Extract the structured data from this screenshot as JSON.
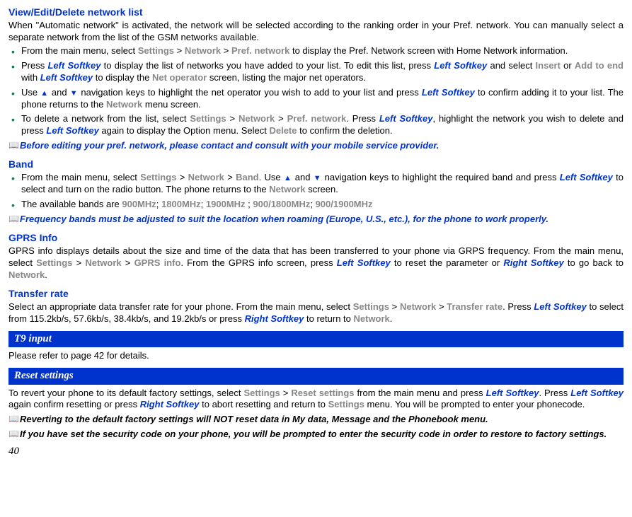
{
  "sections": {
    "viewEditDelete": {
      "title": "View/Edit/Delete network list",
      "intro": "When \"Automatic network\" is activated, the network will be selected according to the ranking order in your Pref. network. You can manually select a separate network from the list of the GSM networks available.",
      "bullets": [
        {
          "pre": "From the main menu, select ",
          "g1": "Settings",
          "gt1": " > ",
          "g2": "Network",
          "gt2": " > ",
          "g3": "Pref. network",
          "tail": " to display the Pref. Network screen with Home Network information."
        },
        {
          "pre": "Press ",
          "lsk1": "Left Softkey",
          "mid1": " to display the list of networks you have added to your list. To edit this list, press ",
          "lsk2": "Left Softkey",
          "mid2": " and select ",
          "g1": "Insert",
          "or": " or ",
          "g2": "Add to end",
          "mid3": " with ",
          "lsk3": "Left Softkey",
          "mid4": "  to display the ",
          "g3": "Net operator",
          "tail": " screen, listing the major net operators."
        },
        {
          "pre": "Use ",
          "aup": "▲",
          "and": " and ",
          "adn": "▼",
          "mid1": " navigation keys to highlight the net operator you wish to add to your list and press ",
          "lsk1": "Left Softkey",
          "mid2": " to confirm adding it to your list. The phone returns to the ",
          "g1": "Network",
          "tail": " menu screen."
        },
        {
          "pre": "To delete a network from the list, select ",
          "g1": "Settings",
          "gt1": " > ",
          "g2": "Network",
          "gt2": " > ",
          "g3": "Pref. network",
          "mid1": ". Press ",
          "lsk1": "Left Softkey",
          "mid2": ", highlight the network you wish to delete and press ",
          "lsk2": "Left Softkey",
          "mid3": " again to display the Option menu. Select ",
          "g4": "Delete",
          "tail": " to confirm the deletion."
        }
      ],
      "note": "Before editing your pref. network, please contact and consult with your mobile service provider."
    },
    "band": {
      "title": "Band",
      "bullets": [
        {
          "pre": "From the main menu, select ",
          "g1": "Settings",
          "gt1": " > ",
          "g2": "Network",
          "gt2": " > ",
          "g3": "Band",
          "mid1": ". Use ",
          "aup": "▲",
          "and": " and ",
          "adn": "▼",
          "mid2": " navigation keys to highlight the required band and press ",
          "lsk1": "Left Softkey",
          "mid3": " to select and turn on the radio button. The phone returns to the ",
          "g4": "Network",
          "tail": " screen."
        },
        {
          "pre": "The available bands are ",
          "g1": "900MHz",
          "sep1": "; ",
          "g2": "1800MHz",
          "sep2": "; ",
          "g3": "1900MHz ",
          "sep3": "; ",
          "g4": "900/1800MHz",
          "sep4": "; ",
          "g5": "900/1900MHz"
        }
      ],
      "note": "Frequency bands must be adjusted to suit the location when roaming (Europe, U.S., etc.), for the phone to work properly."
    },
    "gprs": {
      "title": "GPRS Info",
      "body": {
        "pre": "GPRS info displays details about the size and time of the data that has been transferred to your phone via GRPS frequency. From the main menu, select ",
        "g1": "Settings",
        "gt1": " > ",
        "g2": "Network ",
        "gt2": " > ",
        "g3": "GPRS info",
        "mid1": ". From the GPRS info screen, press ",
        "lsk1": "Left Softkey",
        "mid2": " to reset the parameter or ",
        "rsk1": "Right Softkey",
        "mid3": " to go back to ",
        "g4": "Network",
        "tail": "."
      }
    },
    "transfer": {
      "title": "Transfer rate",
      "body": {
        "pre": "Select an appropriate data transfer rate for your phone. From the main menu, select ",
        "g1": "Settings",
        "gt1": " > ",
        "g2": "Network ",
        "gt2": " > ",
        "g3": "Transfer rate",
        "mid1": ". Press ",
        "lsk1": "Left Softkey",
        "mid2": " to select from 115.2kb/s, 57.6kb/s, 38.4kb/s, and 19.2kb/s or press ",
        "rsk1": "Right Softkey",
        "mid3": " to return to ",
        "g4": "Network",
        "tail": "."
      }
    },
    "t9": {
      "bar": "T9 input",
      "body": "Please refer to page 42 for details."
    },
    "reset": {
      "bar": "Reset settings",
      "body": {
        "pre": "To revert your phone to its default factory settings, select ",
        "g1": "Settings",
        "gt1": " > ",
        "g2": "Reset settings",
        "mid1": " from the main menu and press ",
        "lsk1": "Left Softkey",
        "mid2": ". Press ",
        "lsk2": "Left Softkey",
        "mid3": " again confirm resetting or press ",
        "rsk1": "Right Softkey",
        "mid4": " to abort resetting and return to ",
        "g3": "Settings",
        "tail": " menu. You will be prompted to enter your phonecode."
      },
      "note1": "Reverting to the default factory settings will NOT reset data in My data, Message and the Phonebook menu.",
      "note2": "If you have set the security code on your phone, you will be prompted to enter the security code in order to restore to factory settings."
    }
  },
  "icons": {
    "book": "📖"
  },
  "page": "40"
}
